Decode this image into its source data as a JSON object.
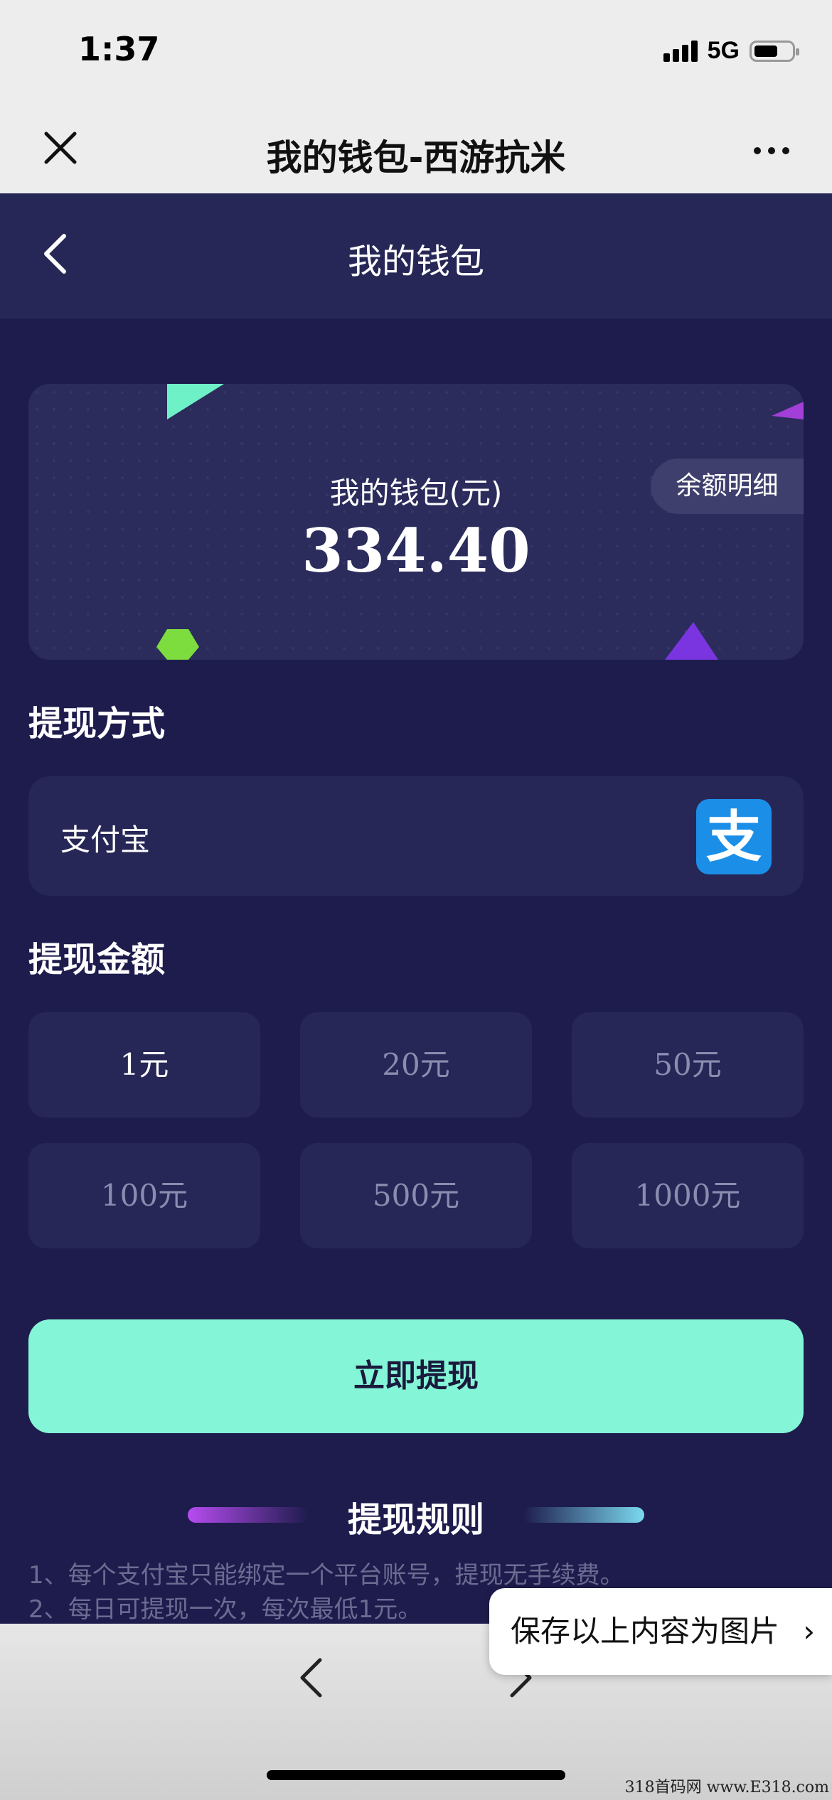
{
  "status_bar": {
    "time": "1:37",
    "network": "5G"
  },
  "wx_bar": {
    "title": "我的钱包-西游抗米",
    "more": "•••"
  },
  "page": {
    "title": "我的钱包"
  },
  "wallet": {
    "label": "我的钱包(元)",
    "balance": "334.40",
    "detail_button": "余额明细"
  },
  "withdraw_method": {
    "section_title": "提现方式",
    "method": "支付宝",
    "icon": "alipay-icon"
  },
  "withdraw_amount": {
    "section_title": "提现金额",
    "options": [
      "1元",
      "20元",
      "50元",
      "100元",
      "500元",
      "1000元"
    ],
    "selected_index": 0
  },
  "withdraw_button": "立即提现",
  "rules": {
    "title": "提现规则",
    "items": [
      "1、每个支付宝只能绑定一个平台账号，提现无手续费。",
      "2、每日可提现一次，每次最低1元。"
    ]
  },
  "save_popup": {
    "label": "保存以上内容为图片",
    "chevron": "›"
  },
  "watermark": "318首码网 www.E318.com",
  "colors": {
    "background": "#1e1c4d",
    "card": "#272757",
    "accent": "#84f5d6",
    "alipay_blue": "#1b8fe8"
  }
}
